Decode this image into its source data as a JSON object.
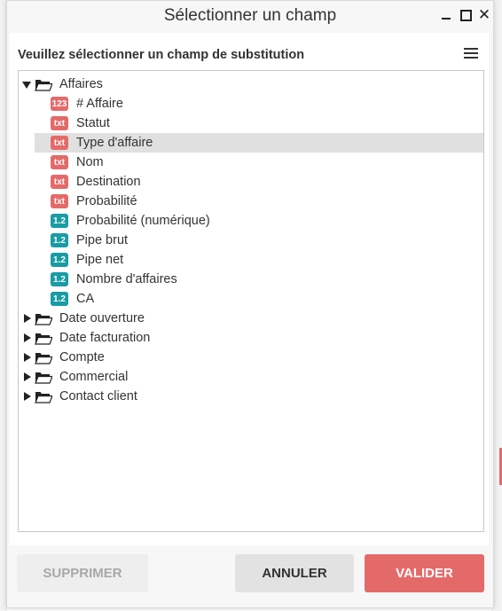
{
  "dialog": {
    "title": "Sélectionner un champ",
    "subtitle": "Veuillez sélectionner un champ de substitution"
  },
  "window_controls": [
    "minimize-icon",
    "maximize-icon",
    "close-icon"
  ],
  "colors": {
    "text_badge": "#e46a6a",
    "number_badge": "#199ca4",
    "validate_button": "#e46a6a",
    "selected_row": "#e0e0e0"
  },
  "tree": {
    "nodes": [
      {
        "type": "folder",
        "expanded": true,
        "label": "Affaires"
      },
      {
        "type": "field",
        "badge": "123",
        "label": "# Affaire"
      },
      {
        "type": "field",
        "badge": "txt",
        "label": "Statut"
      },
      {
        "type": "field",
        "badge": "txt",
        "label": "Type d'affaire",
        "selected": true
      },
      {
        "type": "field",
        "badge": "txt",
        "label": "Nom"
      },
      {
        "type": "field",
        "badge": "txt",
        "label": "Destination"
      },
      {
        "type": "field",
        "badge": "txt",
        "label": "Probabilité"
      },
      {
        "type": "field",
        "badge": "1.2",
        "label": "Probabilité (numérique)"
      },
      {
        "type": "field",
        "badge": "1.2",
        "label": "Pipe brut"
      },
      {
        "type": "field",
        "badge": "1.2",
        "label": "Pipe net"
      },
      {
        "type": "field",
        "badge": "1.2",
        "label": "Nombre d'affaires"
      },
      {
        "type": "field",
        "badge": "1.2",
        "label": "CA"
      },
      {
        "type": "folder",
        "expanded": false,
        "label": "Date ouverture"
      },
      {
        "type": "folder",
        "expanded": false,
        "label": "Date facturation"
      },
      {
        "type": "folder",
        "expanded": false,
        "label": "Compte"
      },
      {
        "type": "folder",
        "expanded": false,
        "label": "Commercial"
      },
      {
        "type": "folder",
        "expanded": false,
        "label": "Contact client"
      }
    ]
  },
  "buttons": {
    "delete": "SUPPRIMER",
    "cancel": "ANNULER",
    "validate": "VALIDER"
  }
}
